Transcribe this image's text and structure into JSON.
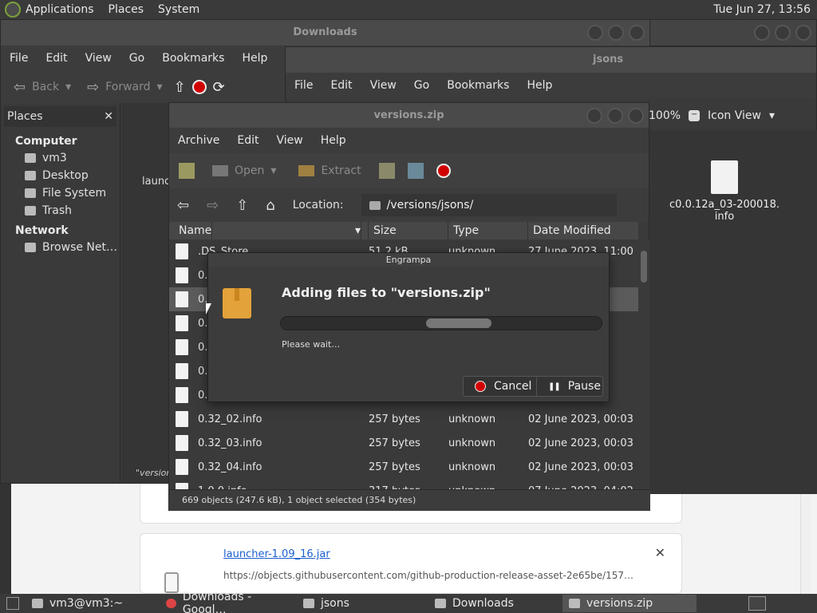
{
  "top_panel": {
    "menus": [
      "Applications",
      "Places",
      "System"
    ],
    "clock": "Tue Jun 27, 13:56"
  },
  "downloads_window": {
    "title": "Downloads",
    "menus": [
      "File",
      "Edit",
      "View",
      "Go",
      "Bookmarks",
      "Help"
    ],
    "toolbar": {
      "back": "Back",
      "forward": "Forward"
    },
    "places_label": "Places",
    "sections": [
      {
        "name": "Computer",
        "items": [
          "vm3",
          "Desktop",
          "File System",
          "Trash"
        ]
      },
      {
        "name": "Network",
        "items": [
          "Browse Net…"
        ]
      }
    ],
    "partial_text": "launc",
    "status_partial": "\"version"
  },
  "jsons_window": {
    "title": "jsons",
    "menus": [
      "File",
      "Edit",
      "View",
      "Go",
      "Bookmarks",
      "Help"
    ],
    "zoom": "100%",
    "view_mode": "Icon View",
    "file_name": "c0.0.12a_03-200018.\ninfo"
  },
  "zip_window": {
    "title": "versions.zip",
    "menus": [
      "Archive",
      "Edit",
      "View",
      "Help"
    ],
    "toolbar": {
      "open": "Open",
      "extract": "Extract"
    },
    "location_label": "Location:",
    "location": "/versions/jsons/",
    "columns": [
      "Name",
      "Size",
      "Type",
      "Date Modified"
    ],
    "rows": [
      {
        "name": ".DS_Store",
        "size": "51.2 kB",
        "type": "unknown",
        "date": "27 June 2023, 11:00",
        "selected": false
      },
      {
        "name": "0.3",
        "size": "",
        "type": "",
        "date": ":09",
        "selected": false
      },
      {
        "name": "0.3",
        "size": "",
        "type": "",
        "date": ":53",
        "selected": true
      },
      {
        "name": "0.3",
        "size": "",
        "type": "",
        "date": ":53",
        "selected": false
      },
      {
        "name": "0.3",
        "size": "",
        "type": "",
        "date": ":53",
        "selected": false
      },
      {
        "name": "0.3",
        "size": "",
        "type": "",
        "date": ":53",
        "selected": false
      },
      {
        "name": "0.3",
        "size": "",
        "type": "",
        "date": "00:03",
        "selected": false
      },
      {
        "name": "0.32_02.info",
        "size": "257 bytes",
        "type": "unknown",
        "date": "02 June 2023, 00:03",
        "selected": false
      },
      {
        "name": "0.32_03.info",
        "size": "257 bytes",
        "type": "unknown",
        "date": "02 June 2023, 00:03",
        "selected": false
      },
      {
        "name": "0.32_04.info",
        "size": "257 bytes",
        "type": "unknown",
        "date": "02 June 2023, 00:03",
        "selected": false
      },
      {
        "name": "1.0.0.info",
        "size": "317 bytes",
        "type": "unknown",
        "date": "07 June 2023, 04:02",
        "selected": false
      }
    ],
    "status": "669 objects (247.6 kB), 1 object selected (354 bytes)"
  },
  "dialog": {
    "title": "Engrampa",
    "heading": "Adding files to \"versions.zip\"",
    "message": "Please wait…",
    "cancel": "Cancel",
    "pause": "Pause"
  },
  "browser": {
    "link": "launcher-1.09_16.jar",
    "url": "https://objects.githubusercontent.com/github-production-release-asset-2e65be/157…",
    "close": "✕"
  },
  "taskbar": {
    "tasks": [
      "vm3@vm3:~",
      "Downloads - Googl…",
      "jsons",
      "Downloads",
      "versions.zip"
    ]
  }
}
